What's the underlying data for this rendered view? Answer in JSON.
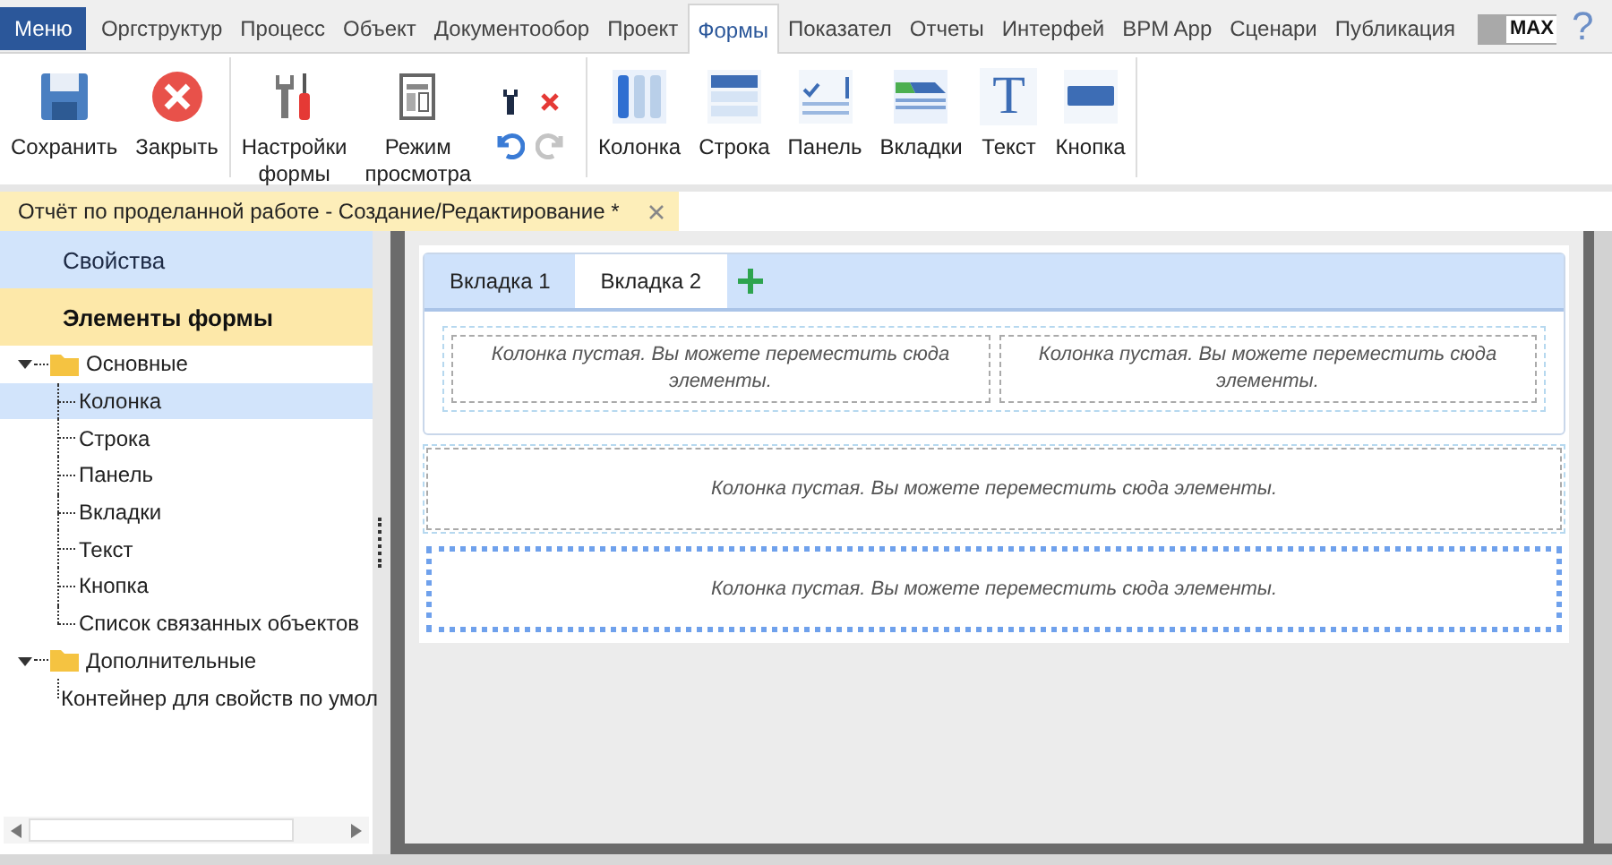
{
  "menu_button": "Меню",
  "tabs": [
    {
      "label": "Оргструктур",
      "selected": false
    },
    {
      "label": "Процесс",
      "selected": false
    },
    {
      "label": "Объект",
      "selected": false
    },
    {
      "label": "Документообор",
      "selected": false
    },
    {
      "label": "Проект",
      "selected": false
    },
    {
      "label": "Формы",
      "selected": true
    },
    {
      "label": "Показател",
      "selected": false
    },
    {
      "label": "Отчеты",
      "selected": false
    },
    {
      "label": "Интерфей",
      "selected": false
    },
    {
      "label": "BPM App",
      "selected": false
    },
    {
      "label": "Сценари",
      "selected": false
    },
    {
      "label": "Публикация",
      "selected": false
    }
  ],
  "max_label": "MAX",
  "help": "?",
  "ribbon": [
    {
      "buttons": [
        {
          "label": "Сохранить"
        },
        {
          "label": "Закрыть"
        }
      ]
    },
    {
      "buttons": [
        {
          "label": "Настройки формы"
        },
        {
          "label": "Режим просмотра"
        }
      ],
      "small": [
        {
          "disabled": false
        },
        {
          "disabled": false
        },
        {
          "disabled": false
        },
        {
          "disabled": true
        }
      ]
    },
    {
      "buttons": [
        {
          "label": "Колонка"
        },
        {
          "label": "Строка"
        },
        {
          "label": "Панель"
        },
        {
          "label": "Вкладки"
        },
        {
          "label": "Текст",
          "glyph": "T"
        },
        {
          "label": "Кнопка"
        }
      ]
    }
  ],
  "document_tab": {
    "title": "Отчёт по проделанной работе - Создание/Редактирование *"
  },
  "sections": [
    {
      "label": "Свойства",
      "selected": false
    },
    {
      "label": "Элементы формы",
      "selected": true
    }
  ],
  "tree": [
    {
      "label": "Основные",
      "expanded": true,
      "selected": false,
      "children": [
        {
          "label": "Колонка",
          "selected": true
        },
        {
          "label": "Строка",
          "selected": false
        },
        {
          "label": "Панель",
          "selected": false
        },
        {
          "label": "Вкладки",
          "selected": false
        },
        {
          "label": "Текст",
          "selected": false
        },
        {
          "label": "Кнопка",
          "selected": false
        },
        {
          "label": "Список связанных объектов",
          "selected": false
        }
      ]
    },
    {
      "label": "Дополнительные",
      "expanded": true,
      "selected": false,
      "children": [
        {
          "label": "Контейнер для свойств по умол",
          "selected": false
        }
      ]
    }
  ],
  "form": [
    {
      "kind": "tabs",
      "selected": false,
      "tabs": [
        {
          "label": "Вкладка 1",
          "selected": false
        },
        {
          "label": "Вкладка 2",
          "selected": true
        }
      ],
      "columns": [
        "Колонка пустая. Вы можете переместить сюда элементы.",
        "Колонка пустая. Вы можете переместить сюда элементы."
      ]
    },
    {
      "kind": "column",
      "selected": false,
      "text": "Колонка пустая. Вы можете переместить сюда элементы."
    },
    {
      "kind": "column",
      "selected": true,
      "text": "Колонка пустая. Вы можете переместить сюда элементы."
    }
  ]
}
